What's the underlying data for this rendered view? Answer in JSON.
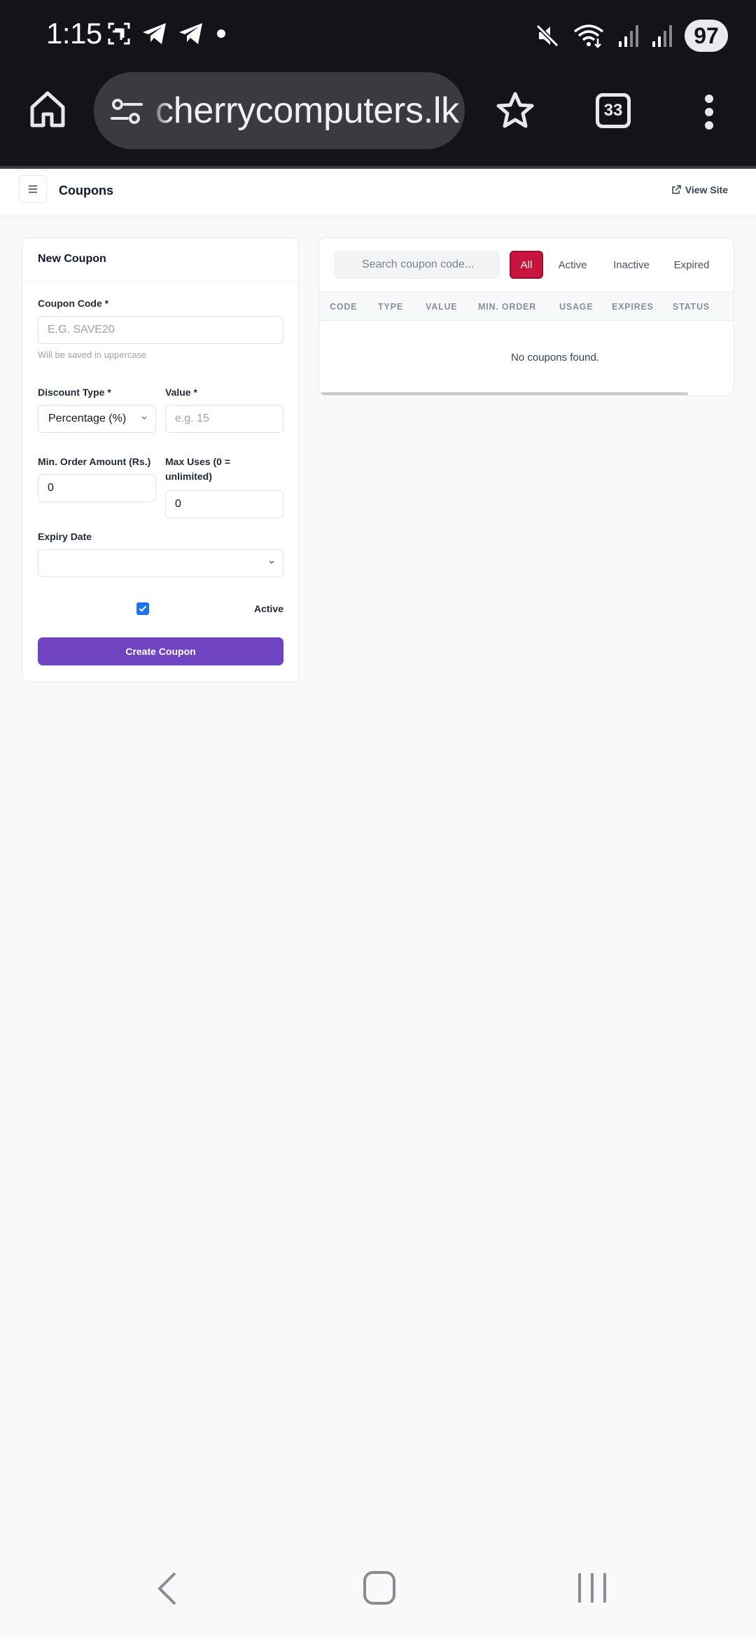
{
  "status_bar": {
    "time": "1:15",
    "battery": "97"
  },
  "browser": {
    "url": "cherrycomputers.lk",
    "tab_count": "33"
  },
  "header": {
    "title": "Coupons",
    "view_site": "View Site"
  },
  "form": {
    "title": "New Coupon",
    "code_label": "Coupon Code *",
    "code_placeholder": "E.G. SAVE20",
    "code_hint": "Will be saved in uppercase",
    "discount_type_label": "Discount Type *",
    "discount_type_value": "Percentage (%)",
    "value_label": "Value *",
    "value_placeholder": "e.g. 15",
    "min_order_label": "Min. Order Amount (Rs.)",
    "min_order_value": "0",
    "max_uses_label_1": "Max Uses (0 =",
    "max_uses_label_2": "unlimited)",
    "max_uses_value": "0",
    "expiry_label": "Expiry Date",
    "expiry_value": "",
    "active_label": "Active",
    "active_checked": true,
    "submit_label": "Create Coupon"
  },
  "list": {
    "search_placeholder": "Search coupon code...",
    "filters": [
      "All",
      "Active",
      "Inactive",
      "Expired"
    ],
    "active_filter": "All",
    "columns": [
      "CODE",
      "TYPE",
      "VALUE",
      "MIN. ORDER",
      "USAGE",
      "EXPIRES",
      "STATUS"
    ],
    "empty_message": "No coupons found."
  },
  "colors": {
    "accent_purple": "#7044c0",
    "filter_active_red": "#c7153f",
    "checkbox_blue": "#1a73e8"
  }
}
